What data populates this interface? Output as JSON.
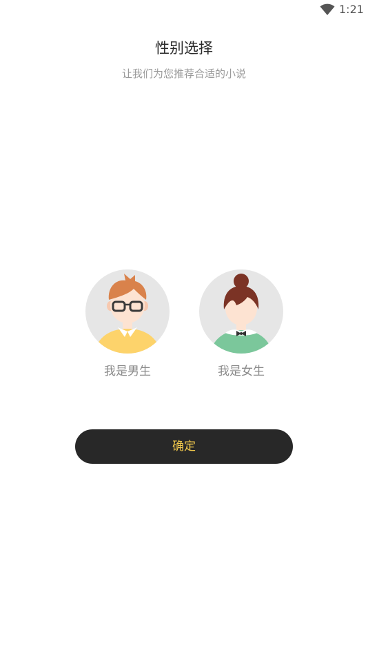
{
  "status_bar": {
    "time": "1:21",
    "wifi_icon": "wifi-icon"
  },
  "header": {
    "title": "性别选择",
    "subtitle": "让我们为您推荐合适的小说"
  },
  "options": {
    "male": {
      "label": "我是男生",
      "icon": "male-avatar-icon",
      "colors": {
        "circle": "#e6e6e6",
        "sweater": "#fdd36b",
        "hair": "#d9824b",
        "skin": "#fde3d2"
      }
    },
    "female": {
      "label": "我是女生",
      "icon": "female-avatar-icon",
      "colors": {
        "circle": "#e6e6e6",
        "sweater": "#7bc79b",
        "hair": "#7b3325",
        "skin": "#fde3d2"
      }
    }
  },
  "confirm": {
    "label": "确定",
    "background": "#282828",
    "text_color": "#f2c94c"
  }
}
